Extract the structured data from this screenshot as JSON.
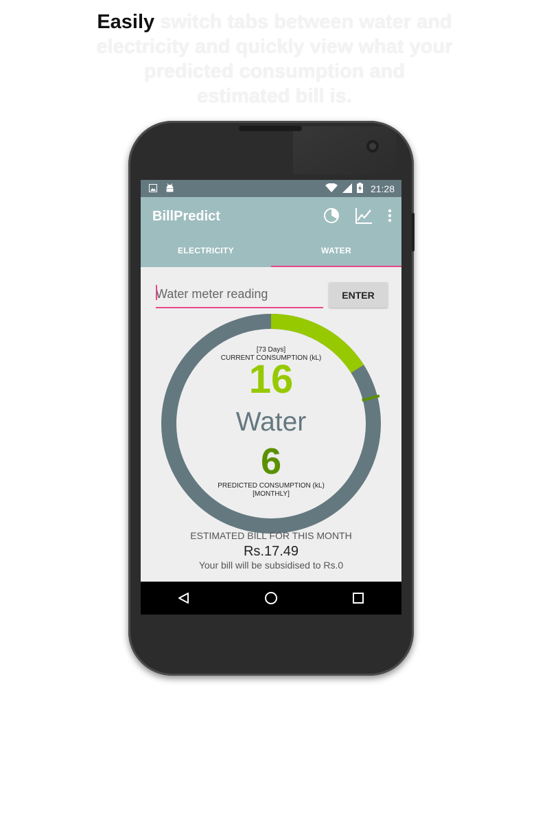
{
  "caption": {
    "lead": "Easily",
    "rest": " switch tabs between water and electricity and quickly view what your predicted consumption and estimated bill is."
  },
  "status_bar": {
    "time": "21:28",
    "icons": [
      "image-icon",
      "android-icon",
      "wifi-icon",
      "signal-icon",
      "battery-charging-icon"
    ]
  },
  "app_bar": {
    "title": "BillPredict",
    "actions": [
      "pie-chart-icon",
      "line-chart-icon",
      "more-vert-icon"
    ]
  },
  "tabs": [
    {
      "label": "ELECTRICITY",
      "active": false
    },
    {
      "label": "WATER",
      "active": true
    }
  ],
  "meter_input": {
    "placeholder": "Water meter reading",
    "value": ""
  },
  "enter_button": "ENTER",
  "gauge": {
    "days_label": "[73 Days]",
    "current_label": "CURRENT CONSUMPTION (kL)",
    "current_value": "16",
    "utility_label": "Water",
    "predicted_value": "6",
    "predicted_label": "PREDICTED CONSUMPTION (kL)",
    "period_label": "[MONTHLY]",
    "progress_fraction": 0.16,
    "marker_fraction": 0.21,
    "colors": {
      "track": "#64787f",
      "progress": "#97c900",
      "marker": "#5a9100"
    }
  },
  "bill": {
    "title": "ESTIMATED BILL FOR THIS MONTH",
    "amount": "Rs.17.49",
    "subsidy_note": "Your bill will be subsidised to Rs.0"
  },
  "nav_bar": [
    "back-icon",
    "home-icon",
    "recents-icon"
  ],
  "colors": {
    "accent": "#e8478c",
    "app_bar": "#9ebdbe",
    "status_bar": "#64787f"
  }
}
